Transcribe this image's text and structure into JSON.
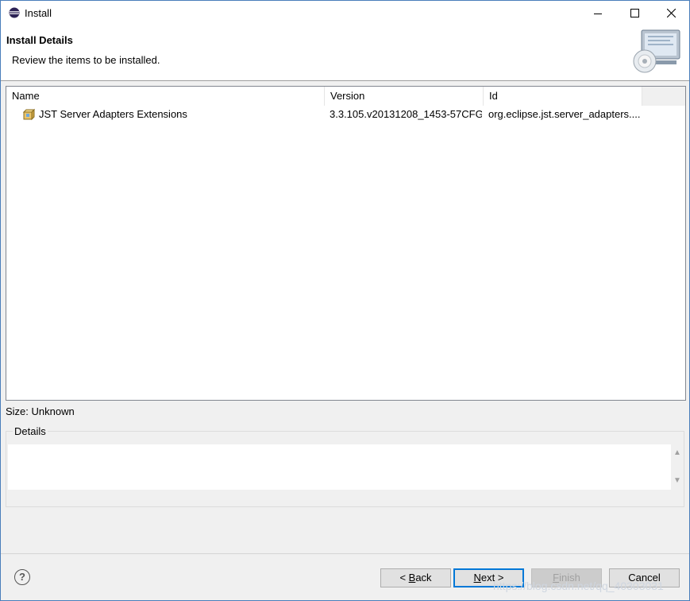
{
  "window": {
    "title": "Install"
  },
  "header": {
    "title": "Install Details",
    "subtitle": "Review the items to be installed."
  },
  "table": {
    "columns": {
      "name": "Name",
      "version": "Version",
      "id": "Id"
    },
    "rows": [
      {
        "name": "JST Server Adapters Extensions",
        "version": "3.3.105.v20131208_1453-57CFG...",
        "id": "org.eclipse.jst.server_adapters...."
      }
    ]
  },
  "size_label": "Size: Unknown",
  "details": {
    "legend": "Details",
    "text": ""
  },
  "buttons": {
    "back": {
      "pre": "< ",
      "mnemonic": "B",
      "post": "ack"
    },
    "next": {
      "pre": "",
      "mnemonic": "N",
      "post": "ext >"
    },
    "finish": {
      "pre": "",
      "mnemonic": "F",
      "post": "inish"
    },
    "cancel": "Cancel"
  },
  "watermark": "https://blog.csdn.net/qq_40303031",
  "colors": {
    "accent": "#0078d7",
    "border": "#828790"
  }
}
